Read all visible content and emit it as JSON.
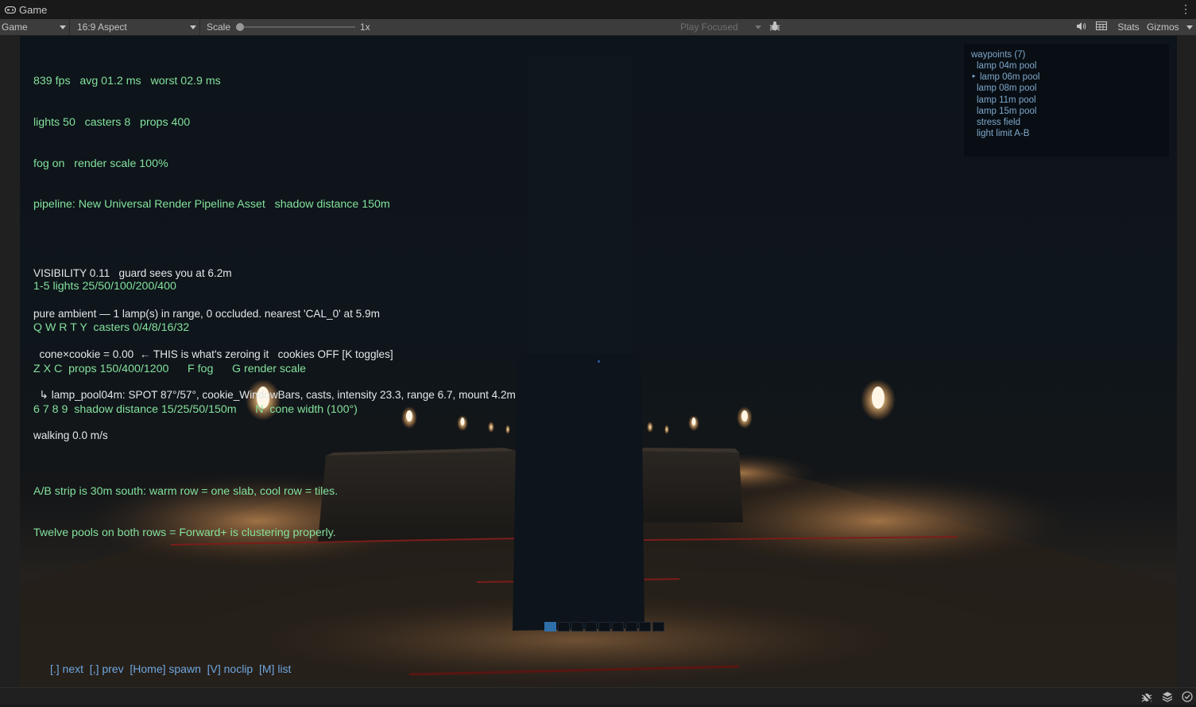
{
  "window": {
    "tab_title": "Game",
    "menu_glyph": "⋮"
  },
  "toolbar": {
    "display": "Game",
    "aspect": "16:9 Aspect",
    "scale_label": "Scale",
    "scale_value": "1x",
    "scale_level": 0.0,
    "play_mode": "Play Focused",
    "stats": "Stats",
    "gizmos": "Gizmos"
  },
  "stats_overlay": {
    "lines": [
      "839 fps   avg 01.2 ms   worst 02.9 ms",
      "lights 50   casters 8   props 400",
      "fog on   render scale 100%",
      "pipeline: New Universal Render Pipeline Asset   shadow distance 150m",
      "",
      "1-5 lights 25/50/100/200/400",
      "Q W R T Y  casters 0/4/8/16/32",
      "Z X C  props 150/400/1200      F fog      G render scale",
      "6 7 8 9  shadow distance 15/25/50/150m      N  cone width (100°)",
      "",
      "A/B strip is 30m south: warm row = one slab, cool row = tiles.",
      "Twelve pools on both rows = Forward+ is clustering properly."
    ]
  },
  "visibility_overlay": {
    "lines": [
      "VISIBILITY 0.11   guard sees you at 6.2m",
      "pure ambient — 1 lamp(s) in range, 0 occluded. nearest 'CAL_0' at 5.9m",
      "  cone×cookie = 0.00  ← THIS is what's zeroing it   cookies OFF [K toggles]",
      "  ↳ lamp_pool04m: SPOT 87°/57°, cookie_WindowBars, casts, intensity 23.3, range 6.7, mount 4.2m",
      "walking 0.0 m/s"
    ]
  },
  "waypoints": {
    "title": "waypoints (7)",
    "items": [
      "lamp 04m pool",
      "lamp 06m pool",
      "lamp 08m pool",
      "lamp 11m pool",
      "lamp 15m pool",
      "stress field",
      "light limit A-B"
    ],
    "selected_index": 1
  },
  "hint_bar": "[.] next  [,] prev  [Home] spawn  [V] noclip  [M] list",
  "hotbar": {
    "slot_count": 9,
    "active_index": 0
  },
  "colors": {
    "stats_text": "#84e19c",
    "visibility_text": "#e2e7ea",
    "waypoint_text": "#7fa8cc",
    "hint_text": "#6ea6de",
    "lamp_warm": "#ffd9a0"
  }
}
